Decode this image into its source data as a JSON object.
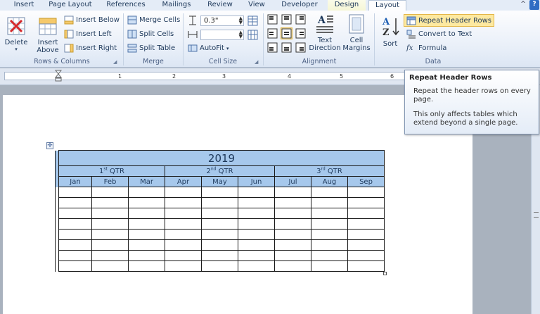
{
  "tabs": [
    {
      "label": "Insert"
    },
    {
      "label": "Page Layout"
    },
    {
      "label": "References"
    },
    {
      "label": "Mailings"
    },
    {
      "label": "Review"
    },
    {
      "label": "View"
    },
    {
      "label": "Developer"
    },
    {
      "label": "Design"
    },
    {
      "label": "Layout"
    }
  ],
  "window": {
    "collapse": "^",
    "help": "?"
  },
  "rows_columns": {
    "delete": "Delete",
    "insert_above_1": "Insert",
    "insert_above_2": "Above",
    "insert_below": "Insert Below",
    "insert_left": "Insert Left",
    "insert_right": "Insert Right",
    "label": "Rows & Columns"
  },
  "merge": {
    "merge_cells": "Merge Cells",
    "split_cells": "Split Cells",
    "split_table": "Split Table",
    "label": "Merge"
  },
  "cell_size": {
    "height_value": "0.3\"",
    "width_value": "",
    "autofit": "AutoFit",
    "label": "Cell Size"
  },
  "alignment": {
    "text_direction_1": "Text",
    "text_direction_2": "Direction",
    "cell_margins_1": "Cell",
    "cell_margins_2": "Margins",
    "label": "Alignment"
  },
  "data_group": {
    "sort": "Sort",
    "repeat_header_rows": "Repeat Header Rows",
    "convert_to_text": "Convert to Text",
    "formula": "Formula",
    "label": "Data"
  },
  "ruler": {
    "marks": [
      "1",
      "2",
      "3",
      "4",
      "5",
      "6"
    ]
  },
  "tooltip": {
    "title": "Repeat Header Rows",
    "body1": "Repeat the header rows on every page.",
    "body2": "This only affects tables which extend beyond a single page."
  },
  "table": {
    "year": "2019",
    "quarters": [
      {
        "num": "1",
        "suffix": "st",
        "label": "QTR"
      },
      {
        "num": "2",
        "suffix": "nd",
        "label": "QTR"
      },
      {
        "num": "3",
        "suffix": "rd",
        "label": "QTR"
      }
    ],
    "months": [
      "Jan",
      "Feb",
      "Mar",
      "Apr",
      "May",
      "Jun",
      "Jul",
      "Aug",
      "Sep"
    ]
  },
  "colors": {
    "header_fill": "#a6c8ec",
    "highlight": "#fde9a0",
    "ribbon_text": "#1e395b"
  }
}
